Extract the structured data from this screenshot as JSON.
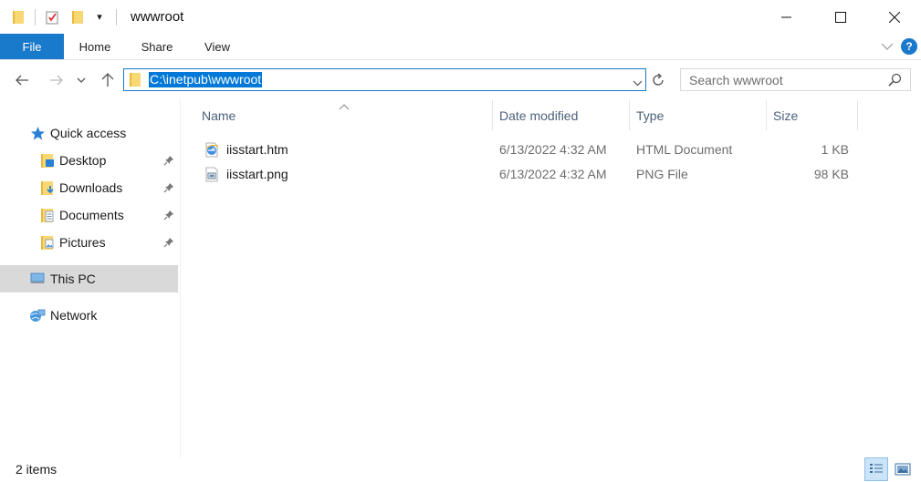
{
  "window": {
    "title": "wwwroot",
    "qa_dropdown": "▾"
  },
  "ribbon": {
    "tabs": [
      "File",
      "Home",
      "Share",
      "View"
    ],
    "help": "?"
  },
  "address": {
    "path": "C:\\inetpub\\wwwroot",
    "search_placeholder": "Search wwwroot"
  },
  "sidebar": {
    "items": [
      {
        "label": "Quick access",
        "icon": "star-icon"
      },
      {
        "label": "Desktop",
        "icon": "desktop-folder-icon",
        "pinned": true
      },
      {
        "label": "Downloads",
        "icon": "downloads-folder-icon",
        "pinned": true
      },
      {
        "label": "Documents",
        "icon": "documents-folder-icon",
        "pinned": true
      },
      {
        "label": "Pictures",
        "icon": "pictures-folder-icon",
        "pinned": true
      },
      {
        "label": "This PC",
        "icon": "computer-icon",
        "selected": true
      },
      {
        "label": "Network",
        "icon": "network-icon"
      }
    ]
  },
  "columns": {
    "name": "Name",
    "date": "Date modified",
    "type": "Type",
    "size": "Size"
  },
  "files": [
    {
      "name": "iisstart.htm",
      "date": "6/13/2022 4:32 AM",
      "type": "HTML Document",
      "size": "1 KB",
      "icon": "html-file-icon"
    },
    {
      "name": "iisstart.png",
      "date": "6/13/2022 4:32 AM",
      "type": "PNG File",
      "size": "98 KB",
      "icon": "image-file-icon"
    }
  ],
  "status": {
    "item_count": "2 items"
  },
  "colors": {
    "accent": "#1979ca",
    "selection": "#0078d7",
    "column_header_text": "#4c607a",
    "folder_yellow": "#f4c542"
  }
}
